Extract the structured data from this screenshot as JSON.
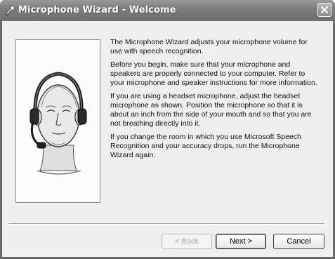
{
  "window": {
    "title": "Microphone Wizard - Welcome",
    "icons": {
      "app": "microphone-wizard-icon",
      "close": "close-icon",
      "illustration": "headset-head-illustration"
    }
  },
  "content": {
    "paragraphs": [
      "The Microphone Wizard adjusts your microphone volume for use with speech recognition.",
      "Before you begin, make sure that your microphone and speakers are properly connected to your computer. Refer to your microphone and speaker instructions for more information.",
      "If you are using a headset microphone, adjust the headset microphone as shown. Position the microphone so that it is about an inch from the side of your mouth and so that you are not breathing directly into it.",
      "If you change the room in which you use Microsoft Speech Recognition and your accuracy drops, run the Microphone Wizard again."
    ]
  },
  "buttons": {
    "back": "< Back",
    "next": "Next >",
    "cancel": "Cancel"
  }
}
